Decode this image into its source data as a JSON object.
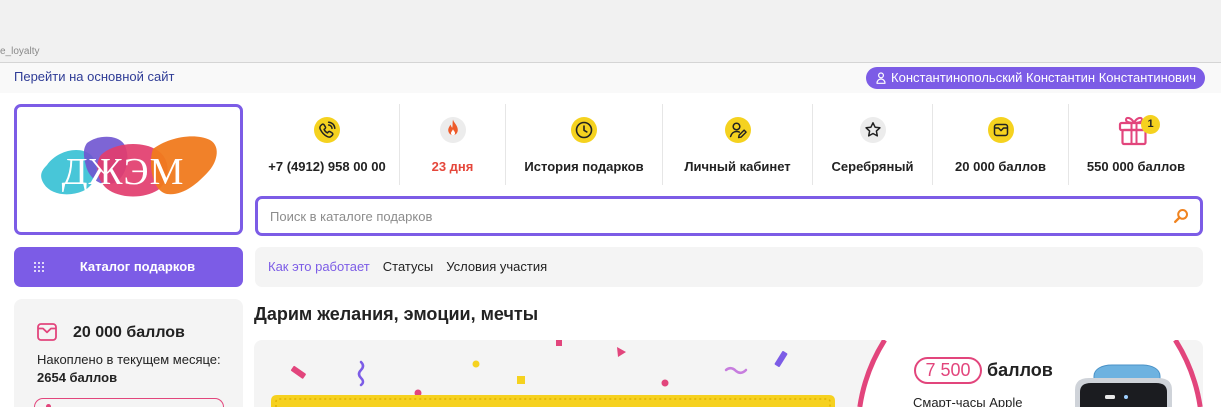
{
  "browser": {
    "address_fragment": "e_loyalty"
  },
  "topbar": {
    "main_site_link": "Перейти на основной сайт",
    "user_name": "Константинопольский Константин Константинович",
    "user_icon": "user-icon"
  },
  "logo": {
    "text": "ДЖЭМ"
  },
  "nav": {
    "items": [
      {
        "icon": "phone-icon",
        "label": "+7 (4912) 958 00 00"
      },
      {
        "icon": "flame-icon",
        "label": "23 дня"
      },
      {
        "icon": "clock-icon",
        "label": "История подарков"
      },
      {
        "icon": "profile-edit-icon",
        "label": "Личный кабинет"
      },
      {
        "icon": "star-icon",
        "label": "Серебряный"
      },
      {
        "icon": "wallet-icon",
        "label": "20 000 баллов"
      },
      {
        "icon": "gift-icon",
        "label": "550 000 баллов",
        "badge": "1"
      }
    ]
  },
  "search": {
    "placeholder": "Поиск в каталоге подарков",
    "icon": "search-icon"
  },
  "catalog_button": {
    "label": "Каталог подарков",
    "icon": "grid-icon"
  },
  "tabs": [
    {
      "label": "Как это работает",
      "active": true
    },
    {
      "label": "Статусы",
      "active": false
    },
    {
      "label": "Условия участия",
      "active": false
    }
  ],
  "heading": "Дарим желания, эмоции, мечты",
  "balance_card": {
    "icon": "wallet-icon",
    "points": "20 000 баллов",
    "accrued_label": "Накоплено в текущем месяце:",
    "accrued_value": "2654 баллов"
  },
  "promo": {
    "price": "7 500",
    "price_unit": "баллов",
    "product": "Смарт-часы Apple"
  },
  "colors": {
    "accent": "#7c5ce6",
    "yellow": "#f5d21f",
    "pink": "#e2457c",
    "red": "#e5473b",
    "link": "#2f3c96"
  }
}
